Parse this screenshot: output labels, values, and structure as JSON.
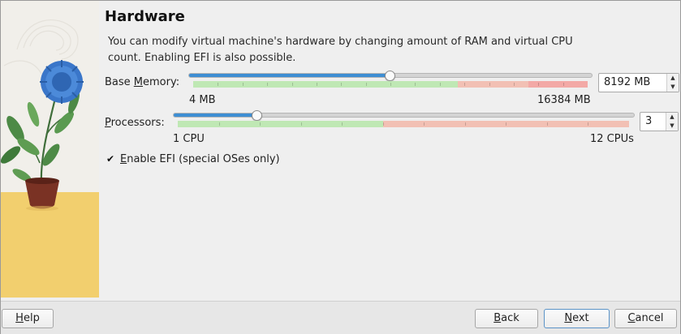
{
  "wizard": {
    "title": "Hardware",
    "description": "You can modify virtual machine's hardware by changing amount of RAM and virtual CPU count. Enabling EFI is also possible."
  },
  "memory": {
    "label_prefix": "Base ",
    "label_mnemonic": "M",
    "label_rest": "emory:",
    "min_label": "4 MB",
    "max_label": "16384 MB",
    "value": "8192 MB",
    "slider_fraction": 0.5
  },
  "processors": {
    "label_mnemonic": "P",
    "label_rest": "rocessors:",
    "min_label": "1 CPU",
    "max_label": "12 CPUs",
    "value": "3",
    "slider_fraction": 0.182
  },
  "efi": {
    "checked": true,
    "label_mnemonic": "E",
    "label_rest": "nable EFI (special OSes only)"
  },
  "buttons": {
    "help_mnemonic": "H",
    "help_rest": "elp",
    "back_mnemonic": "B",
    "back_rest": "ack",
    "next_mnemonic": "N",
    "next_rest": "ext",
    "cancel_mnemonic": "C",
    "cancel_rest": "ancel"
  },
  "colors": {
    "slider_fill": "#3e8ed3",
    "range_ok": "#bfe8b4",
    "range_warn": "#f2c0b4",
    "range_bad": "#f3a9a6",
    "watermark_floor": "#f2cf6e"
  },
  "icons": {
    "check": "✔",
    "spin_up": "▲",
    "spin_down": "▼"
  }
}
